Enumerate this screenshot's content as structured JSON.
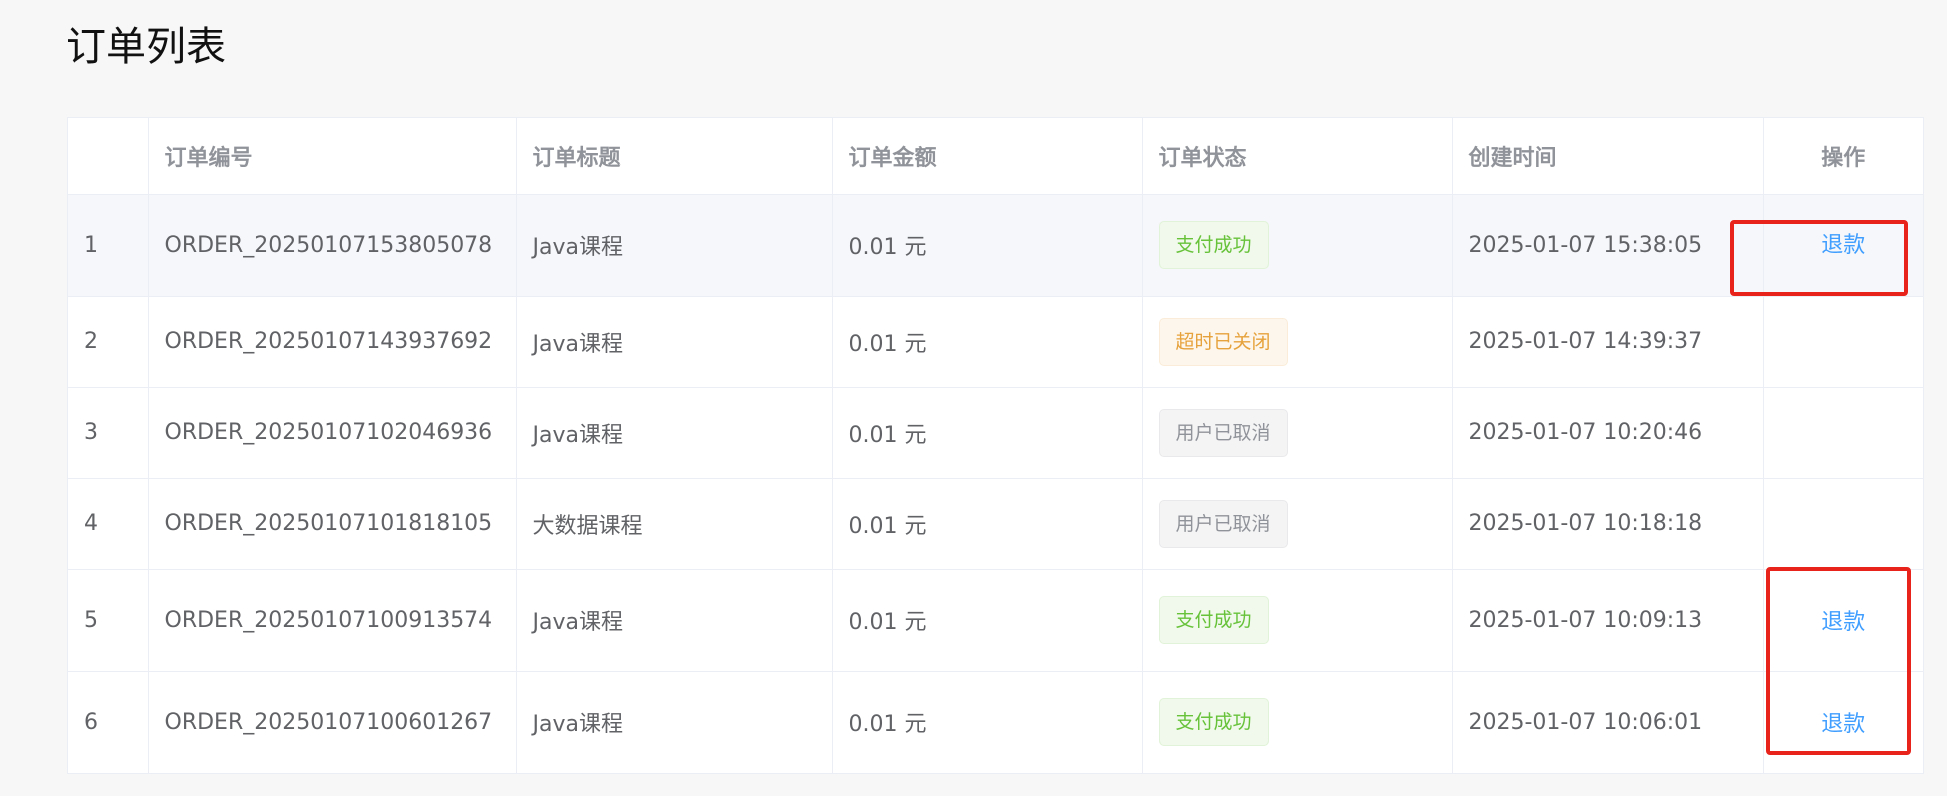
{
  "page": {
    "title": "订单列表"
  },
  "table": {
    "columns": {
      "index": "",
      "order_no": "订单编号",
      "order_title": "订单标题",
      "amount": "订单金额",
      "status": "订单状态",
      "created": "创建时间",
      "action": "操作"
    },
    "rows": [
      {
        "index": "1",
        "order_no": "ORDER_20250107153805078",
        "order_title": "Java课程",
        "amount": "0.01 元",
        "status": "支付成功",
        "status_type": "success",
        "created": "2025-01-07 15:38:05",
        "action": "退款"
      },
      {
        "index": "2",
        "order_no": "ORDER_20250107143937692",
        "order_title": "Java课程",
        "amount": "0.01 元",
        "status": "超时已关闭",
        "status_type": "warning",
        "created": "2025-01-07 14:39:37",
        "action": ""
      },
      {
        "index": "3",
        "order_no": "ORDER_20250107102046936",
        "order_title": "Java课程",
        "amount": "0.01 元",
        "status": "用户已取消",
        "status_type": "info",
        "created": "2025-01-07 10:20:46",
        "action": ""
      },
      {
        "index": "4",
        "order_no": "ORDER_20250107101818105",
        "order_title": "大数据课程",
        "amount": "0.01 元",
        "status": "用户已取消",
        "status_type": "info",
        "created": "2025-01-07 10:18:18",
        "action": ""
      },
      {
        "index": "5",
        "order_no": "ORDER_20250107100913574",
        "order_title": "Java课程",
        "amount": "0.01 元",
        "status": "支付成功",
        "status_type": "success",
        "created": "2025-01-07 10:09:13",
        "action": "退款"
      },
      {
        "index": "6",
        "order_no": "ORDER_20250107100601267",
        "order_title": "Java课程",
        "amount": "0.01 元",
        "status": "支付成功",
        "status_type": "success",
        "created": "2025-01-07 10:06:01",
        "action": "退款"
      }
    ]
  },
  "colors": {
    "success": "#67c23a",
    "warning": "#e6a23c",
    "info": "#909399",
    "link": "#409eff",
    "annotation": "#e8231b"
  }
}
